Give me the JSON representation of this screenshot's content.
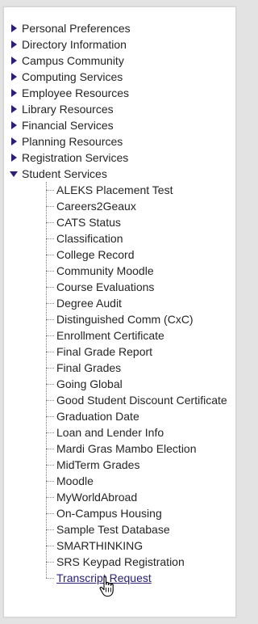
{
  "menu": {
    "categories": [
      "Personal Preferences",
      "Directory Information",
      "Campus Community",
      "Computing Services",
      "Employee Resources",
      "Library Resources",
      "Financial Services",
      "Planning Resources",
      "Registration Services",
      "Student Services"
    ],
    "student_services_items": [
      "ALEKS Placement Test",
      "Careers2Geaux",
      "CATS Status",
      "Classification",
      "College Record",
      "Community Moodle",
      "Course Evaluations",
      "Degree Audit",
      "Distinguished Comm (CxC)",
      "Enrollment Certificate",
      "Final Grade Report",
      "Final Grades",
      "Going Global",
      "Good Student Discount Certificate",
      "Graduation Date",
      "Loan and Lender Info",
      "Mardi Gras Mambo Election",
      "MidTerm Grades",
      "Moodle",
      "MyWorldAbroad",
      "On-Campus Housing",
      "Sample Test Database",
      "SMARTHINKING",
      "SRS Keypad Registration",
      "Transcript Request"
    ]
  },
  "colors": {
    "accent": "#2a2078",
    "text": "#252525",
    "background": "#e3e3e3"
  },
  "icons": {
    "collapsed": "triangle-right-icon",
    "expanded": "triangle-down-icon",
    "cursor": "hand-pointer-icon"
  }
}
